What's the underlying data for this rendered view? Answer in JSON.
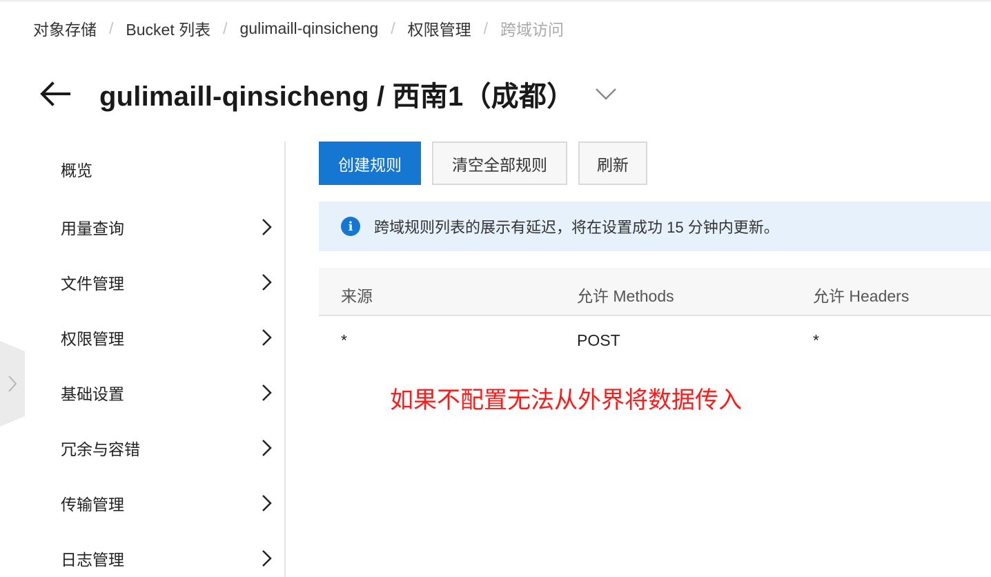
{
  "breadcrumb": {
    "items": [
      "对象存储",
      "Bucket 列表",
      "gulimaill-qinsicheng",
      "权限管理",
      "跨域访问"
    ],
    "separator": "/"
  },
  "header": {
    "title": "gulimaill-qinsicheng / 西南1（成都）"
  },
  "sidebar": {
    "items": [
      {
        "label": "概览"
      },
      {
        "label": "用量查询"
      },
      {
        "label": "文件管理"
      },
      {
        "label": "权限管理"
      },
      {
        "label": "基础设置"
      },
      {
        "label": "冗余与容错"
      },
      {
        "label": "传输管理"
      },
      {
        "label": "日志管理"
      }
    ]
  },
  "toolbar": {
    "create_label": "创建规则",
    "clear_label": "清空全部规则",
    "refresh_label": "刷新"
  },
  "notice": {
    "icon": "info-icon",
    "text": "跨域规则列表的展示有延迟，将在设置成功 15 分钟内更新。"
  },
  "table": {
    "headers": [
      "来源",
      "允许 Methods",
      "允许 Headers"
    ],
    "rows": [
      [
        "*",
        "POST",
        "*"
      ]
    ]
  },
  "annotation": "如果不配置无法从外界将数据传入",
  "colors": {
    "primary": "#1677d2",
    "notice_bg": "#e6f1fb",
    "annotation": "#ff1a1a"
  }
}
